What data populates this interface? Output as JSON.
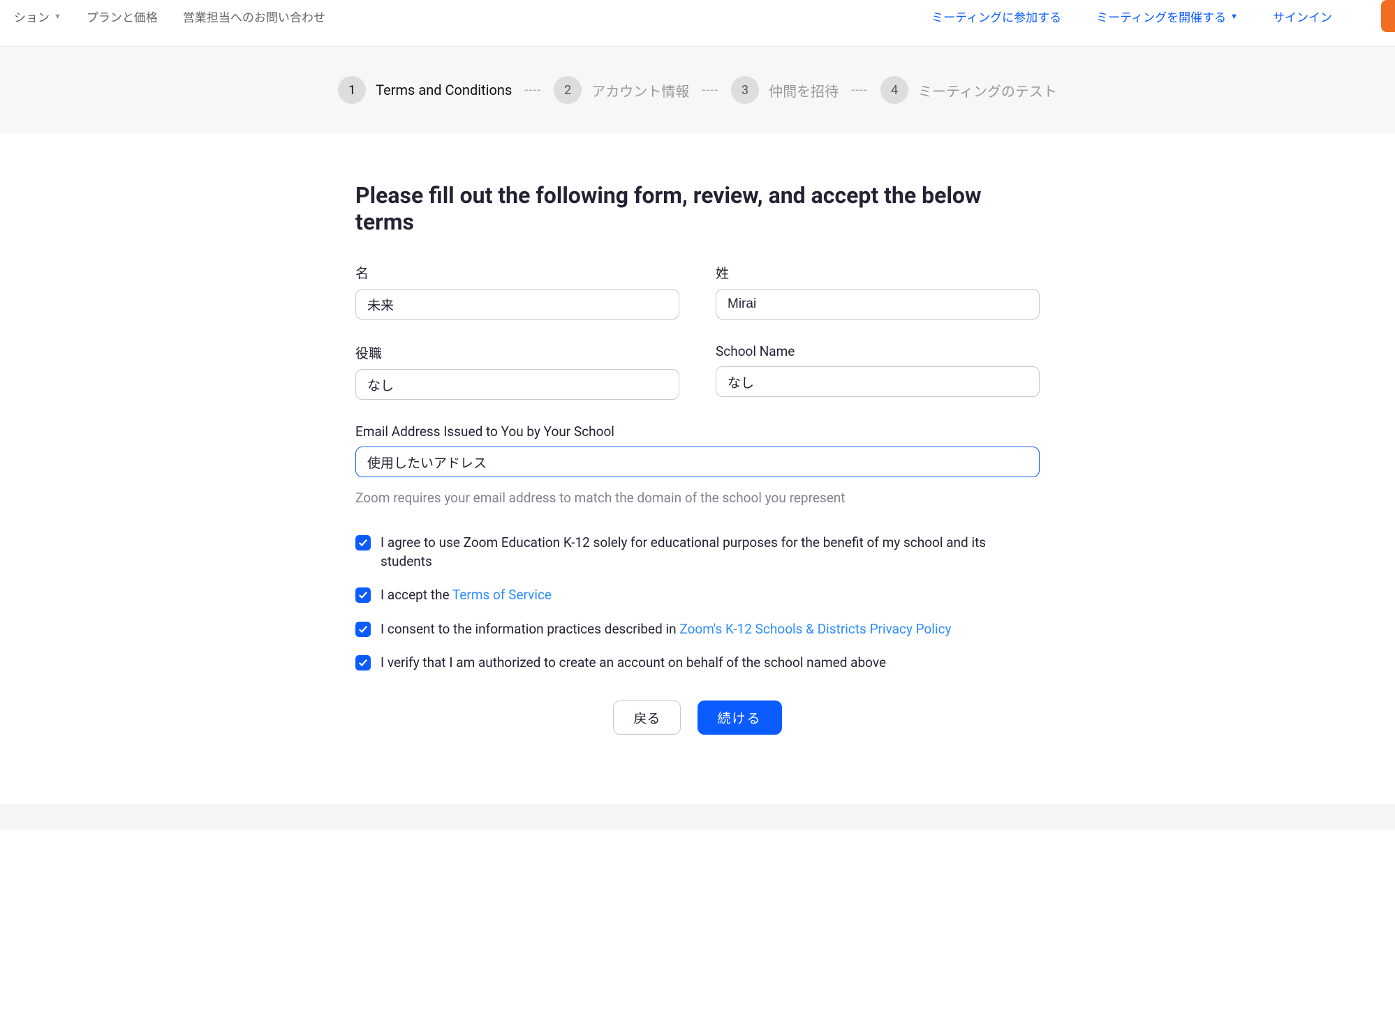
{
  "nav": {
    "left": [
      "ション",
      "プランと価格",
      "営業担当へのお問い合わせ"
    ],
    "right": [
      "ミーティングに参加する",
      "ミーティングを開催する",
      "サインイン"
    ]
  },
  "steps": [
    {
      "num": "1",
      "label": "Terms and Conditions"
    },
    {
      "num": "2",
      "label": "アカウント情報"
    },
    {
      "num": "3",
      "label": "仲間を招待"
    },
    {
      "num": "4",
      "label": "ミーティングのテスト"
    }
  ],
  "step_sep": "----",
  "headline": "Please fill out the following form, review, and accept the below terms",
  "fields": {
    "first_name": {
      "label": "名",
      "value": "未来"
    },
    "last_name": {
      "label": "姓",
      "value": "Mirai"
    },
    "position": {
      "label": "役職",
      "value": "なし"
    },
    "school_name": {
      "label": "School Name",
      "value": "なし"
    },
    "email": {
      "label": "Email Address Issued to You by Your School",
      "value": "使用したいアドレス",
      "helper": "Zoom requires your email address to match the domain of the school you represent"
    }
  },
  "checks": {
    "c1": "I agree to use Zoom Education K-12 solely for educational purposes for the benefit of my school and its students",
    "c2_prefix": "I accept the ",
    "c2_link": "Terms of Service",
    "c3_prefix": "I consent to the information practices described in ",
    "c3_link": "Zoom's K-12 Schools & Districts Privacy Policy",
    "c4": "I verify that I am authorized to create an account on behalf of the school named above"
  },
  "buttons": {
    "back": "戻る",
    "continue": "続ける"
  }
}
